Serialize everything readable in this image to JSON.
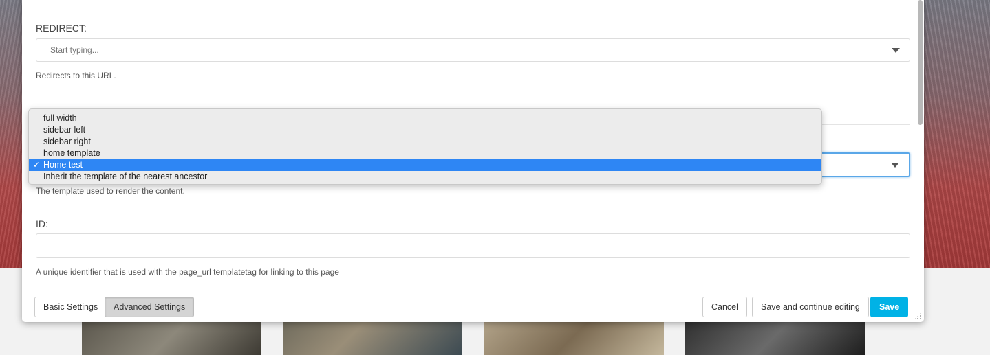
{
  "modal": {
    "redirect": {
      "label": "REDIRECT:",
      "placeholder": "Start typing...",
      "help": "Redirects to this URL."
    },
    "template": {
      "help": "The template used to render the content.",
      "options": [
        {
          "label": "full width",
          "selected": false
        },
        {
          "label": "sidebar left",
          "selected": false
        },
        {
          "label": "sidebar right",
          "selected": false
        },
        {
          "label": "home template",
          "selected": false
        },
        {
          "label": "Home test",
          "selected": true
        },
        {
          "label": "Inherit the template of the nearest ancestor",
          "selected": false
        }
      ],
      "check_glyph": "✓"
    },
    "id_field": {
      "label": "ID:",
      "value": "",
      "help": "A unique identifier that is used with the page_url templatetag for linking to this page"
    },
    "footer": {
      "basic_settings": "Basic Settings",
      "advanced_settings": "Advanced Settings",
      "cancel": "Cancel",
      "save_continue": "Save and continue editing",
      "save": "Save"
    }
  },
  "colors": {
    "primary": "#00b2e6",
    "selection": "#2e86f4",
    "focus": "#5aa7e8"
  }
}
